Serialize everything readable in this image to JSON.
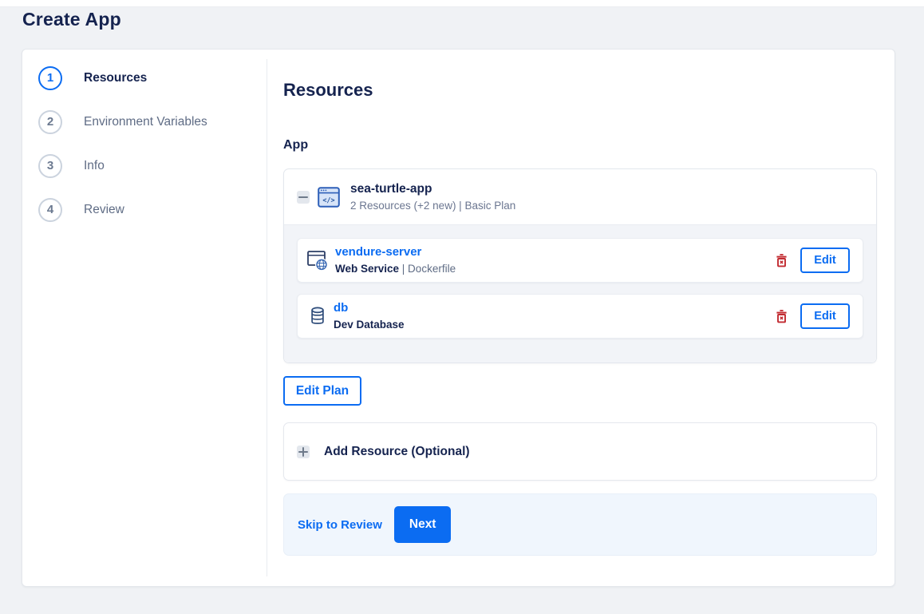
{
  "header": {
    "title": "Create App"
  },
  "stepper": {
    "steps": [
      {
        "number": "1",
        "label": "Resources",
        "active": true
      },
      {
        "number": "2",
        "label": "Environment Variables",
        "active": false
      },
      {
        "number": "3",
        "label": "Info",
        "active": false
      },
      {
        "number": "4",
        "label": "Review",
        "active": false
      }
    ]
  },
  "content": {
    "heading": "Resources",
    "group_label": "App",
    "app_card": {
      "name": "sea-turtle-app",
      "summary": "2 Resources (+2 new) | Basic Plan",
      "resources": [
        {
          "name": "vendure-server",
          "type": "Web Service",
          "type_suffix": " | Dockerfile",
          "edit_label": "Edit",
          "icon": "web-service-icon"
        },
        {
          "name": "db",
          "type": "Dev Database",
          "type_suffix": "",
          "edit_label": "Edit",
          "icon": "database-icon"
        }
      ]
    },
    "edit_plan_label": "Edit Plan",
    "add_resource_label": "Add Resource (Optional)",
    "footer": {
      "skip_label": "Skip to Review",
      "next_label": "Next"
    }
  },
  "icons": {
    "app_glyph": "</>"
  },
  "colors": {
    "accent": "#0b6cf2",
    "danger": "#c22a30",
    "navy": "#15234f"
  }
}
